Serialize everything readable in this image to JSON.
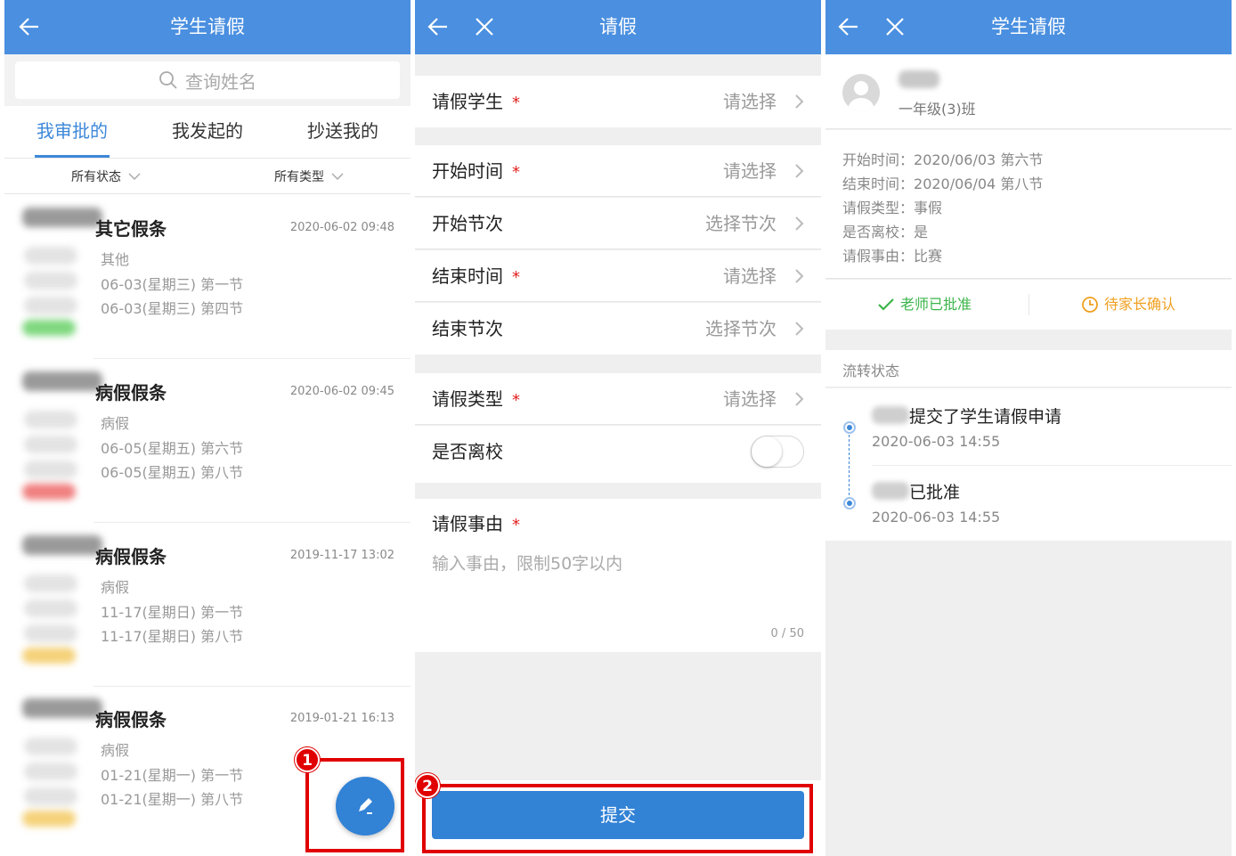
{
  "panel1": {
    "title": "学生请假",
    "search_placeholder": "查询姓名",
    "tabs": [
      "我审批的",
      "我发起的",
      "抄送我的"
    ],
    "filters": [
      "所有状态",
      "所有类型"
    ],
    "items": [
      {
        "type": "其它假条",
        "time": "2020-06-02 09:48",
        "reason": "其他",
        "start": "06-03(星期三) 第一节",
        "end": "06-03(星期三) 第四节",
        "badge_color": "#7fd87f"
      },
      {
        "type": "病假假条",
        "time": "2020-06-02 09:45",
        "reason": "病假",
        "start": "06-05(星期五) 第六节",
        "end": "06-05(星期五) 第八节",
        "badge_color": "#f08080"
      },
      {
        "type": "病假假条",
        "time": "2019-11-17 13:02",
        "reason": "病假",
        "start": "11-17(星期日) 第一节",
        "end": "11-17(星期日) 第八节",
        "badge_color": "#f5d27a"
      },
      {
        "type": "病假假条",
        "time": "2019-01-21 16:13",
        "reason": "病假",
        "start": "01-21(星期一) 第一节",
        "end": "01-21(星期一) 第八节",
        "badge_color": "#f5d27a"
      }
    ],
    "step_badge": "1"
  },
  "panel2": {
    "title": "请假",
    "rows": {
      "student": {
        "label": "请假学生",
        "value": "请选择"
      },
      "start_time": {
        "label": "开始时间",
        "value": "请选择"
      },
      "start_period": {
        "label": "开始节次",
        "value": "选择节次"
      },
      "end_time": {
        "label": "结束时间",
        "value": "请选择"
      },
      "end_period": {
        "label": "结束节次",
        "value": "选择节次"
      },
      "leave_type": {
        "label": "请假类型",
        "value": "请选择"
      },
      "leave_school": {
        "label": "是否离校"
      }
    },
    "required_mark": "*",
    "reason_label": "请假事由",
    "reason_placeholder": "输入事由，限制50字以内",
    "reason_count": "0 / 50",
    "submit_label": "提交",
    "step_badge": "2"
  },
  "panel3": {
    "title": "学生请假",
    "class_name": "一年级(3)班",
    "details": [
      {
        "label": "开始时间：",
        "value": "2020/06/03 第六节"
      },
      {
        "label": "结束时间：",
        "value": "2020/06/04 第八节"
      },
      {
        "label": "请假类型：",
        "value": "事假"
      },
      {
        "label": "是否离校：",
        "value": "是"
      },
      {
        "label": "请假事由：",
        "value": "比赛"
      }
    ],
    "status_approved": "老师已批准",
    "status_pending": "待家长确认",
    "flow_title": "流转状态",
    "flow": [
      {
        "text": "提交了学生请假申请",
        "time": "2020-06-03 14:55"
      },
      {
        "text": "已批准",
        "time": "2020-06-03 14:55"
      }
    ]
  },
  "colors": {
    "primary": "#4a8fe0",
    "accent": "#3282d6",
    "highlight": "#e00000",
    "approved": "#3bb54a",
    "pending": "#f0a020"
  }
}
